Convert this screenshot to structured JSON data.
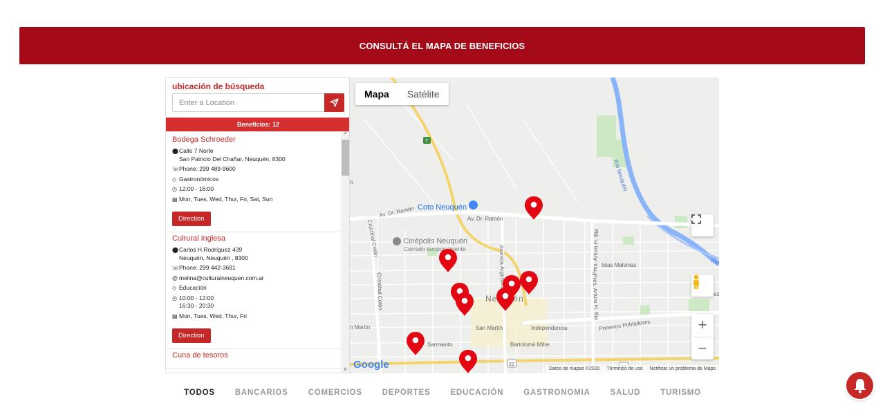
{
  "banner": {
    "title": "CONSULTÁ EL MAPA DE BENEFICIOS"
  },
  "search": {
    "title": "ubicación de búsqueda",
    "placeholder": "Enter a Location",
    "count_label": "Beneficios: 12"
  },
  "listings": [
    {
      "name": "Bodega Schroeder",
      "address_line1": "Calle 7 Norte",
      "address_line2": "San Patricio Del Chañar, Neuquén, 8300",
      "phone": "Phone: 299 489-9600",
      "category": "Gastronómicos",
      "hours_line1": "12:00 - 16:00",
      "days": "Mon, Tues, Wed, Thur, Fri, Sat, Sun",
      "button": "Direction"
    },
    {
      "name": "Culrural Inglesa",
      "address_line1": "Carlos H.Rodríguez 439",
      "address_line2": "Neuquén, Neuquén , 8300",
      "phone": "Phone: 299 442-3691",
      "email": "melina@culturalneuquen.com.ar",
      "category": "Educación",
      "hours_line1": "10:00 - 12:00",
      "hours_line2": "16:30 - 20:30",
      "days": "Mon, Tues, Wed, Thur, Fri",
      "button": "Direction"
    },
    {
      "name": "Cuna de tesoros"
    }
  ],
  "map": {
    "type_map": "Mapa",
    "type_satellite": "Satélite",
    "google": "Google",
    "attribution": [
      "Datos de mapas ©2020",
      "Términos de uso",
      "Notificar un problema de Maps"
    ],
    "labels": {
      "coto": "Coto Neuquén",
      "cinepolis": "Cinépolis Neuquén",
      "cinepolis_sub": "Cerrado temporalmente",
      "av_ramon_1": "Av. Dr. Ramón",
      "av_ramon_2": "Av. Dr. Ramón",
      "cristobal_colon_1": "Cristóbal Colón",
      "cristobal_colon_2": "Cristóbal Colón",
      "avenida_argentina": "Avenida Argentina",
      "islas_malvinas": "Islas Malvinas",
      "pres_illia_1": "Pres. Arturo H. Illia",
      "pres_illia_2": "Pres. Arturo H. Illia",
      "neuquen": "Neuquén",
      "san_martin_1": "n Martín",
      "san_martin_2": "San Martín",
      "independencia": "Independencia",
      "primeros_pobladores": "Primeros Pobladores",
      "sarmiento": "Sarmiento",
      "bartolome_mitre": "Bartolomé Mitre",
      "rio_neuquen": "Río Neuquén",
      "rio": "Río",
      "route_7": "7",
      "route_22": "22",
      "route_22b": "22",
      "n_edge": "n",
      "ezo": "ezo"
    },
    "marker_color": "#e30613"
  },
  "categories": [
    "TODOS",
    "BANCARIOS",
    "COMERCIOS",
    "DEPORTES",
    "EDUCACIÓN",
    "GASTRONOMIA",
    "SALUD",
    "TURISMO"
  ],
  "colors": {
    "brand": "#a50a19",
    "accent": "#c62828"
  }
}
